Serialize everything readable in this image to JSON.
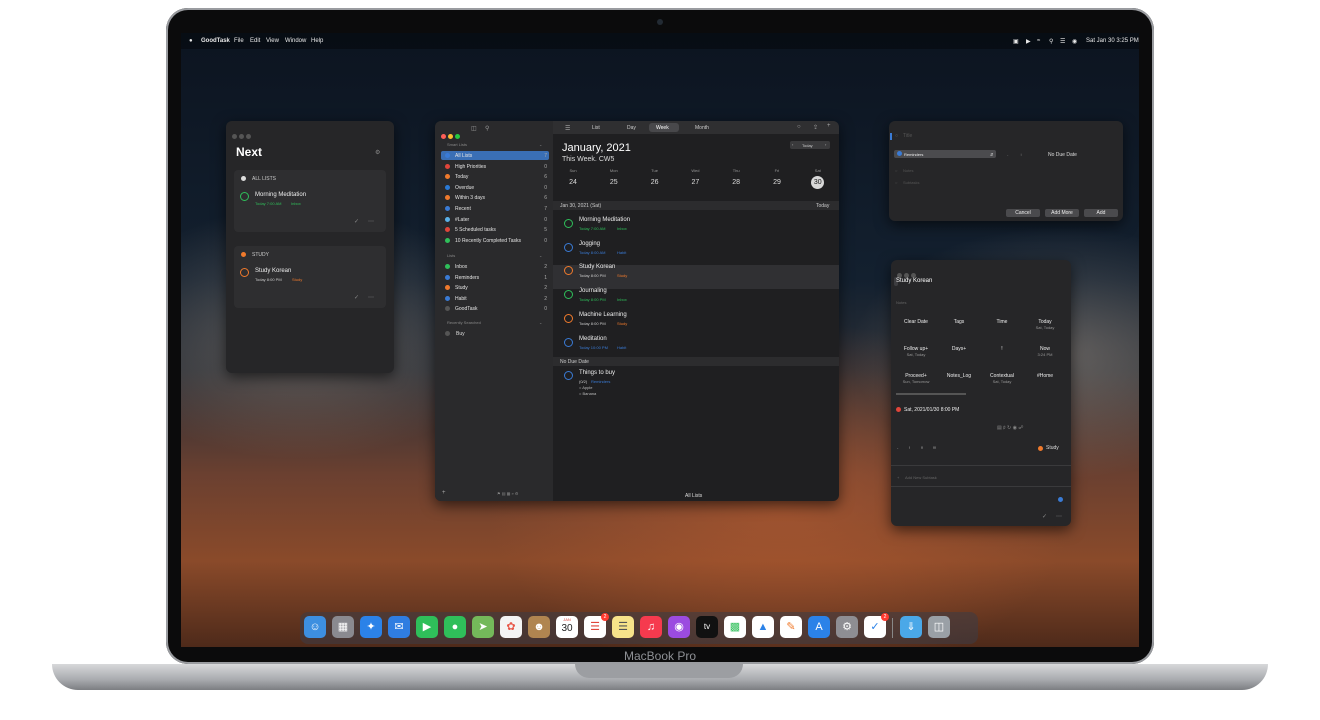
{
  "menubar": {
    "app_name": "GoodTask",
    "menus": [
      "File",
      "Edit",
      "View",
      "Window",
      "Help"
    ],
    "clock": "Sat Jan 30  3:25 PM"
  },
  "next_window": {
    "title": "Next",
    "sections": [
      {
        "header": "ALL LISTS",
        "task": "Morning Meditation",
        "time": "Today 7:00 AM",
        "list": "Inbox",
        "color": "#2fbf5a"
      },
      {
        "header": "STUDY",
        "task": "Study Korean",
        "time": "Today 8:00 PM",
        "list": "Study",
        "color": "#f07a2c"
      }
    ]
  },
  "main_window": {
    "toolbar_tabs": [
      "List",
      "Day",
      "Week",
      "Month"
    ],
    "active_tab": "Week",
    "smart_lists_header": "Smart Lists",
    "smart_lists": [
      {
        "label": "All Lists",
        "count": "7",
        "color": "#3a7bd5"
      },
      {
        "label": "High Priorities",
        "count": "0",
        "color": "#e0453a"
      },
      {
        "label": "Today",
        "count": "6",
        "color": "#f07a2c"
      },
      {
        "label": "Overdue",
        "count": "0",
        "color": "#2a7ad6"
      },
      {
        "label": "Within 3 days",
        "count": "6",
        "color": "#f07a2c"
      },
      {
        "label": "Recent",
        "count": "7",
        "color": "#3a7bd5"
      },
      {
        "label": "#Later",
        "count": "0",
        "color": "#5ab0e8"
      },
      {
        "label": "5 Scheduled tasks",
        "count": "5",
        "color": "#e0453a"
      },
      {
        "label": "10 Recently Completed Tasks",
        "count": "0",
        "color": "#2fbf5a"
      }
    ],
    "lists_header": "Lists",
    "lists": [
      {
        "label": "Inbox",
        "count": "2",
        "color": "#2fbf5a"
      },
      {
        "label": "Reminders",
        "count": "1",
        "color": "#3a7bd5"
      },
      {
        "label": "Study",
        "count": "2",
        "color": "#f07a2c"
      },
      {
        "label": "Habit",
        "count": "2",
        "color": "#3a7bd5"
      },
      {
        "label": "GoodTask",
        "count": "0",
        "color": "#555"
      }
    ],
    "recently_searched_header": "Recently Searched",
    "recent_search": "Buy",
    "month_title": "January, 2021",
    "week_subtitle": "This Week. CW5",
    "today_button": "Today",
    "days": [
      {
        "name": "Sun",
        "num": "24"
      },
      {
        "name": "Mon",
        "num": "25"
      },
      {
        "name": "Tue",
        "num": "26"
      },
      {
        "name": "Wed",
        "num": "27"
      },
      {
        "name": "Thu",
        "num": "28"
      },
      {
        "name": "Fri",
        "num": "29"
      },
      {
        "name": "Sat",
        "num": "30"
      }
    ],
    "date_header": "Jan 30, 2021 (Sat)",
    "date_header_right": "Today",
    "tasks": [
      {
        "title": "Morning Meditation",
        "time": "Today 7:00 AM",
        "list": "Inbox",
        "color": "#2fbf5a"
      },
      {
        "title": "Jogging",
        "time": "Today 8:00 AM",
        "list": "Habit",
        "color": "#3a7bd5"
      },
      {
        "title": "Study Korean",
        "time": "Today 8:00 PM",
        "list": "Study",
        "color": "#f07a2c"
      },
      {
        "title": "Journaling",
        "time": "Today 8:00 PM",
        "list": "Inbox",
        "color": "#2fbf5a"
      },
      {
        "title": "Machine Learning",
        "time": "Today 8:00 PM",
        "list": "Study",
        "color": "#f07a2c"
      },
      {
        "title": "Meditation",
        "time": "Today 10:00 PM",
        "list": "Habit",
        "color": "#3a7bd5"
      }
    ],
    "no_due_header": "No Due Date",
    "no_due_task": {
      "title": "Things to buy",
      "meta": "(0/2)",
      "list": "Reminders",
      "notes": [
        "= Apple",
        "= Banana"
      ]
    },
    "footer": "All Lists"
  },
  "quick_add": {
    "title_placeholder": "Title",
    "list_select": "Reminders",
    "no_due": "No Due Date",
    "notes_placeholder": "Notes",
    "subtasks_placeholder": "Subtasks",
    "cancel": "Cancel",
    "add_more": "Add More",
    "add": "Add"
  },
  "detail": {
    "task_title": "Study Korean",
    "notes_placeholder": "Notes",
    "grid": [
      {
        "main": "Clear Date",
        "sub": ""
      },
      {
        "main": "Tags",
        "sub": ""
      },
      {
        "main": "Time",
        "sub": ""
      },
      {
        "main": "Today",
        "sub": "Sat, Today"
      },
      {
        "main": "Follow up+",
        "sub": "Sat, Today"
      },
      {
        "main": "Days+",
        "sub": ""
      },
      {
        "main": "!",
        "sub": ""
      },
      {
        "main": "Now",
        "sub": "3:24 PM"
      },
      {
        "main": "Proceed+",
        "sub": "Sun, Tomorrow"
      },
      {
        "main": "Notes_Log",
        "sub": ""
      },
      {
        "main": "Contextual",
        "sub": "Sat, Today"
      },
      {
        "main": "#Home",
        "sub": ""
      }
    ],
    "due_line": "Sat, 2021/01/30 8:00 PM",
    "priority_items": [
      "-",
      "!",
      "!!",
      "!!!"
    ],
    "list_name": "Study",
    "add_subtask": "Add New Subtask"
  },
  "dock": {
    "calendar_day": "30",
    "calendar_month": "JAN",
    "reminders_badge": "2",
    "goodtask_badge": "2",
    "appletv_label": "tv"
  },
  "laptop": {
    "brand": "MacBook Pro"
  },
  "colors": {
    "accent_blue": "#3a7bd5",
    "green": "#2fbf5a",
    "orange": "#f07a2c"
  }
}
